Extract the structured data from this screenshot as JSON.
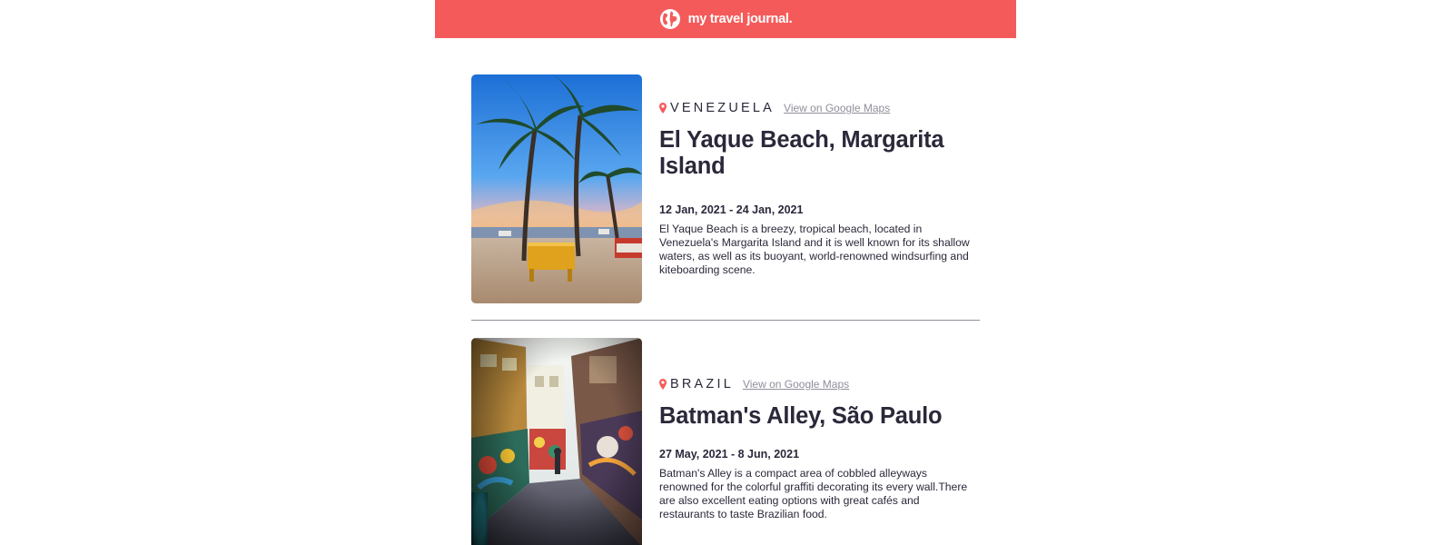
{
  "header": {
    "brand": "my travel journal.",
    "icon": "globe-icon"
  },
  "entries": [
    {
      "country": "VENEZUELA",
      "maps_link": "View on Google Maps",
      "title": "El Yaque Beach, Margarita Island",
      "dates": "12 Jan, 2021 - 24 Jan, 2021",
      "description": "El Yaque Beach is a breezy, tropical beach, located in Venezuela's Margarita Island and it is well known for its shallow waters, as well as its buoyant, world-renowned windsurfing and kiteboarding scene.",
      "image": "beach-palm-trees-photo"
    },
    {
      "country": "BRAZIL",
      "maps_link": "View on Google Maps",
      "title": "Batman's Alley, São Paulo",
      "dates": "27 May, 2021 - 8 Jun, 2021",
      "description": "Batman's Alley is a compact area of cobbled alleyways renowned for the colorful graffiti decorating its every wall.There are also excellent eating options with great cafés and restaurants to taste Brazilian food.",
      "image": "graffiti-alley-photo"
    }
  ],
  "colors": {
    "accent": "#f55a5a",
    "text": "#2b283a",
    "muted": "#918e9b"
  }
}
